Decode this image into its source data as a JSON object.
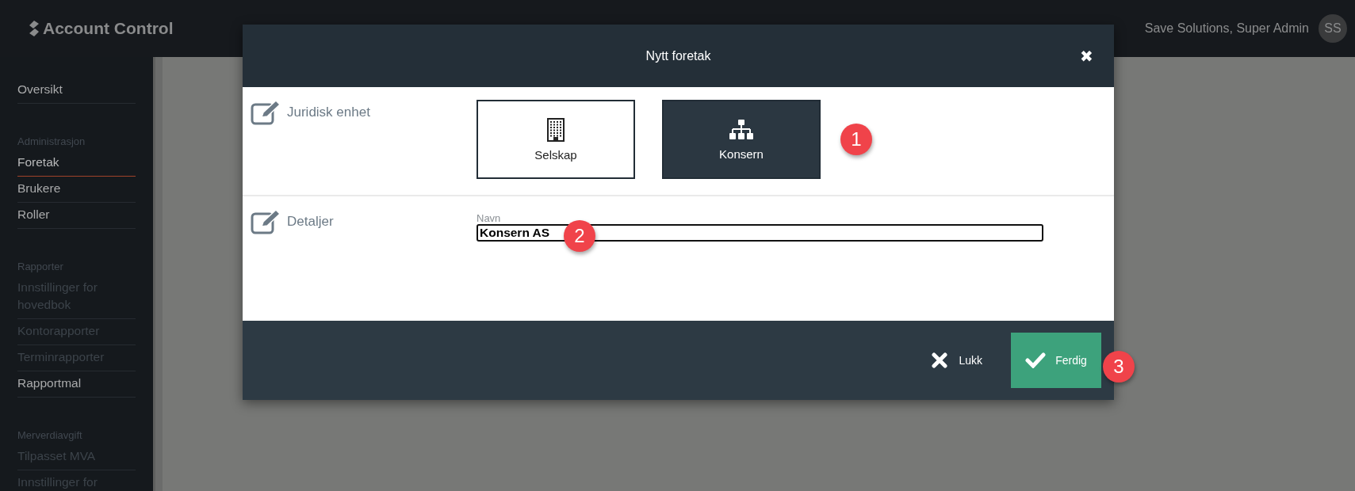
{
  "app": {
    "logo": "Account Control",
    "user": "Save Solutions, Super Admin",
    "avatar": "SS"
  },
  "sidebar": {
    "sections": [
      {
        "items": [
          {
            "label": "Oversikt",
            "selected": false,
            "disabled": false
          }
        ]
      },
      {
        "heading": "Administrasjon",
        "items": [
          {
            "label": "Foretak",
            "selected": true,
            "disabled": false
          },
          {
            "label": "Brukere",
            "selected": false,
            "disabled": false
          },
          {
            "label": "Roller",
            "selected": false,
            "disabled": false
          }
        ]
      },
      {
        "heading": "Rapporter",
        "items": [
          {
            "label": "Innstillinger for hovedbok",
            "selected": false,
            "disabled": true
          },
          {
            "label": "Kontorapporter",
            "selected": false,
            "disabled": true
          },
          {
            "label": "Terminrapporter",
            "selected": false,
            "disabled": true
          },
          {
            "label": "Rapportmal",
            "selected": false,
            "disabled": false
          }
        ]
      },
      {
        "heading": "Merverdiavgift",
        "items": [
          {
            "label": "Tilpasset MVA",
            "selected": false,
            "disabled": true
          },
          {
            "label": "Innstillinger for",
            "selected": false,
            "disabled": true
          }
        ]
      }
    ]
  },
  "dialog": {
    "title": "Nytt foretak",
    "close": "✖",
    "sections": [
      {
        "kind": "choice",
        "label": "Juridisk enhet",
        "callout": "1",
        "options": [
          {
            "label": "Selskap",
            "kind": "building",
            "selected": false
          },
          {
            "label": "Konsern",
            "kind": "hierarchy",
            "selected": true
          }
        ]
      },
      {
        "kind": "fields",
        "label": "Detaljer",
        "callout": "2",
        "fields": [
          {
            "label": "Navn",
            "value": "Konsern AS"
          }
        ]
      }
    ],
    "footer": {
      "cancel": "Lukk",
      "confirm": "Ferdig",
      "callout": "3"
    }
  }
}
